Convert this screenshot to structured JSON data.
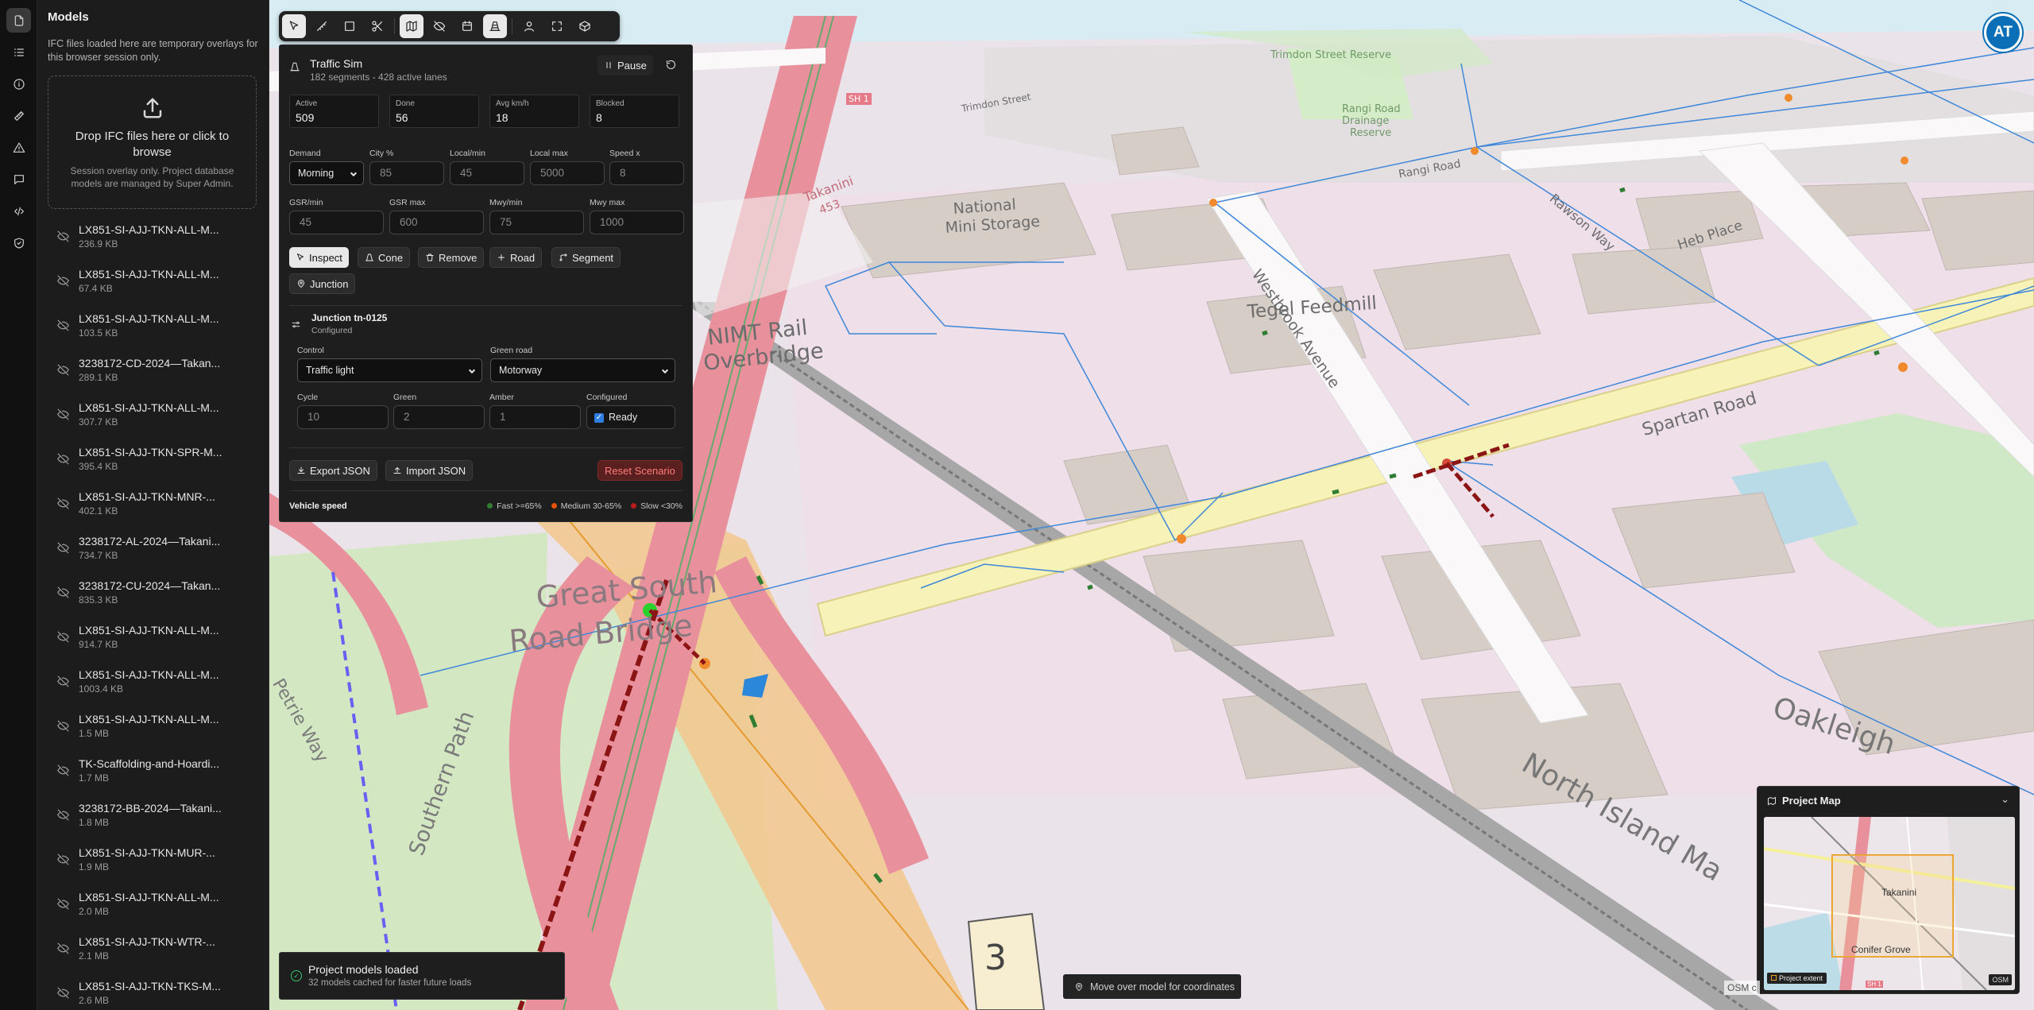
{
  "rail": {
    "icons": [
      "models-icon",
      "layers-list-icon",
      "info-icon",
      "ruler-icon",
      "warning-icon",
      "chat-icon",
      "code-icon",
      "shield-icon"
    ]
  },
  "models": {
    "title": "Models",
    "note": "IFC files loaded here are temporary overlays for this browser session only.",
    "drop_title": "Drop IFC files here or click to browse",
    "drop_sub": "Session overlay only. Project database models are managed by Super Admin.",
    "files": [
      {
        "name": "LX851-SI-AJJ-TKN-ALL-M...",
        "size": "236.9 KB"
      },
      {
        "name": "LX851-SI-AJJ-TKN-ALL-M...",
        "size": "67.4 KB"
      },
      {
        "name": "LX851-SI-AJJ-TKN-ALL-M...",
        "size": "103.5 KB"
      },
      {
        "name": "3238172-CD-2024—Takan...",
        "size": "289.1 KB"
      },
      {
        "name": "LX851-SI-AJJ-TKN-ALL-M...",
        "size": "307.7 KB"
      },
      {
        "name": "LX851-SI-AJJ-TKN-SPR-M...",
        "size": "395.4 KB"
      },
      {
        "name": "LX851-SI-AJJ-TKN-MNR-...",
        "size": "402.1 KB"
      },
      {
        "name": "3238172-AL-2024—Takani...",
        "size": "734.7 KB"
      },
      {
        "name": "3238172-CU-2024—Takan...",
        "size": "835.3 KB"
      },
      {
        "name": "LX851-SI-AJJ-TKN-ALL-M...",
        "size": "914.7 KB"
      },
      {
        "name": "LX851-SI-AJJ-TKN-ALL-M...",
        "size": "1003.4 KB"
      },
      {
        "name": "LX851-SI-AJJ-TKN-ALL-M...",
        "size": "1.5 MB"
      },
      {
        "name": "TK-Scaffolding-and-Hoardi...",
        "size": "1.7 MB"
      },
      {
        "name": "3238172-BB-2024—Takani...",
        "size": "1.8 MB"
      },
      {
        "name": "LX851-SI-AJJ-TKN-MUR-...",
        "size": "1.9 MB"
      },
      {
        "name": "LX851-SI-AJJ-TKN-ALL-M...",
        "size": "2.0 MB"
      },
      {
        "name": "LX851-SI-AJJ-TKN-WTR-...",
        "size": "2.1 MB"
      },
      {
        "name": "LX851-SI-AJJ-TKN-TKS-M...",
        "size": "2.6 MB"
      }
    ]
  },
  "toolbar": {
    "tools": [
      "select-tool-icon",
      "measure-tool-icon",
      "box-select-icon",
      "cut-icon",
      "map-icon",
      "hide-icon",
      "calendar-icon",
      "traffic-cone-icon",
      "person-icon",
      "fullscreen-icon",
      "cube-icon"
    ],
    "active": [
      0,
      4,
      7
    ]
  },
  "sim": {
    "title": "Traffic Sim",
    "subtitle": "182 segments - 428 active lanes",
    "pause_label": "Pause",
    "stats": [
      {
        "label": "Active",
        "value": "509"
      },
      {
        "label": "Done",
        "value": "56"
      },
      {
        "label": "Avg km/h",
        "value": "18"
      },
      {
        "label": "Blocked",
        "value": "8"
      }
    ],
    "demand_label": "Demand",
    "demand_value": "Morning",
    "city_label": "City %",
    "city_value": "85",
    "local_min_label": "Local/min",
    "local_min_value": "45",
    "local_max_label": "Local max",
    "local_max_value": "5000",
    "speed_label": "Speed x",
    "speed_value": "8",
    "gsr_min_label": "GSR/min",
    "gsr_min_value": "45",
    "gsr_max_label": "GSR max",
    "gsr_max_value": "600",
    "mwy_min_label": "Mwy/min",
    "mwy_min_value": "75",
    "mwy_max_label": "Mwy max",
    "mwy_max_value": "1000",
    "tools": {
      "inspect": "Inspect",
      "cone": "Cone",
      "remove": "Remove",
      "road": "Road",
      "segment": "Segment",
      "junction": "Junction"
    },
    "junction_title": "Junction tn-0125",
    "junction_status": "Configured",
    "control_label": "Control",
    "control_value": "Traffic light",
    "green_road_label": "Green road",
    "green_road_value": "Motorway",
    "cycle_label": "Cycle",
    "cycle_value": "10",
    "green_label": "Green",
    "green_value": "2",
    "amber_label": "Amber",
    "amber_value": "1",
    "configured_label": "Configured",
    "ready_label": "Ready",
    "export_label": "Export JSON",
    "import_label": "Import JSON",
    "reset_label": "Reset Scenario",
    "speed_legend_title": "Vehicle speed",
    "legend": [
      {
        "label": "Fast >=65%",
        "color": "#2e7d32"
      },
      {
        "label": "Medium 30-65%",
        "color": "#e65100"
      },
      {
        "label": "Slow <30%",
        "color": "#b71c1c"
      }
    ]
  },
  "map_labels": {
    "great_south": "Great South",
    "road_bridge": "Road Bridge",
    "nimt_rail": "NIMT Rail",
    "overbridge": "Overbridge",
    "national": "National",
    "mini_storage": "Mini Storage",
    "tegel": "Tegel Feedmill",
    "westbrook": "Westbrook Avenue",
    "spartan": "Spartan Road",
    "heb": "Heb Place",
    "rangi": "Rangi Road",
    "rangi_reserve_1": "Rangi Road",
    "rangi_reserve_2": "Drainage",
    "rangi_reserve_3": "Reserve",
    "trimdon": "Trimdon Street Reserve",
    "trimdon_st": "Trimdon Street",
    "north_island": "North Island Ma",
    "oakleigh": "Oakleigh",
    "southern_path": "Southern Path",
    "petrie_way": "Petrie Way",
    "rawson_way": "Rawson Way",
    "takanini": "Takanini",
    "takanini_num": "453",
    "sh": "SH 1",
    "shield_num": "3"
  },
  "logo": {
    "text": "AT"
  },
  "project_map": {
    "title": "Project Map",
    "extent_label": "Project extent",
    "osm_label": "OSM",
    "suburb_1": "Takanini",
    "suburb_2": "Conifer Grove",
    "road_label": "SH 1"
  },
  "toast": {
    "title": "Project models loaded",
    "sub": "32 models cached for faster future loads"
  },
  "coords": {
    "text": "Move over model for coordinates"
  },
  "osm_attribution": "OSM c"
}
